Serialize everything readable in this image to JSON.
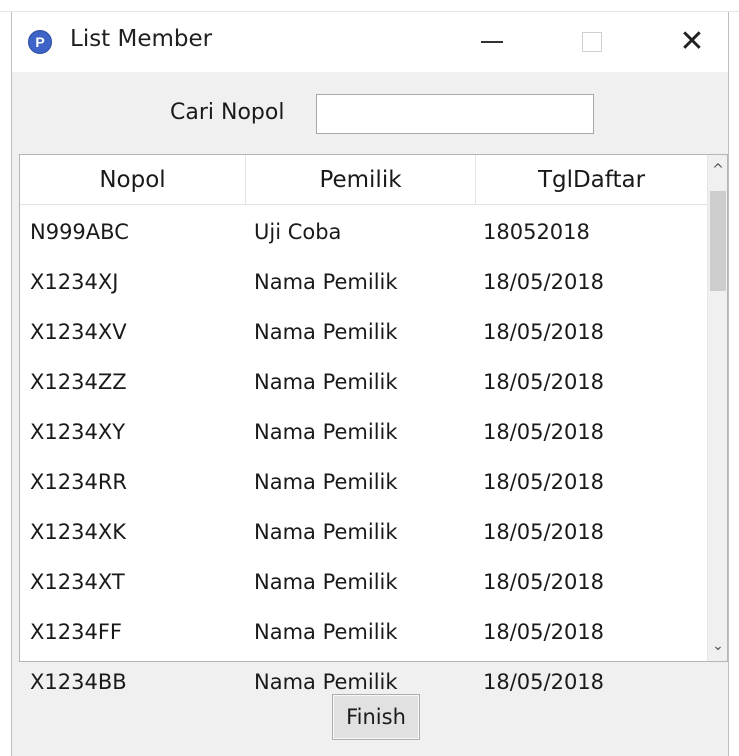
{
  "window": {
    "title": "List Member",
    "icon_letter": "P",
    "close_glyph": "✕"
  },
  "search": {
    "label": "Cari Nopol",
    "value": "",
    "placeholder": ""
  },
  "table": {
    "columns": [
      "Nopol",
      "Pemilik",
      "TglDaftar"
    ],
    "rows": [
      [
        "N999ABC",
        "Uji Coba",
        "18052018"
      ],
      [
        "X1234XJ",
        "Nama Pemilik",
        "18/05/2018"
      ],
      [
        "X1234XV",
        "Nama Pemilik",
        "18/05/2018"
      ],
      [
        "X1234ZZ",
        "Nama Pemilik",
        "18/05/2018"
      ],
      [
        "X1234XY",
        "Nama Pemilik",
        "18/05/2018"
      ],
      [
        "X1234RR",
        "Nama Pemilik",
        "18/05/2018"
      ],
      [
        "X1234XK",
        "Nama Pemilik",
        "18/05/2018"
      ],
      [
        "X1234XT",
        "Nama Pemilik",
        "18/05/2018"
      ],
      [
        "X1234FF",
        "Nama Pemilik",
        "18/05/2018"
      ],
      [
        "X1234BB",
        "Nama Pemilik",
        "18/05/2018"
      ]
    ]
  },
  "scrollbar": {
    "up_glyph": "^",
    "down_glyph": "⌄"
  },
  "footer": {
    "finish_label": "Finish"
  },
  "colors": {
    "window_bg": "#f0f0f0",
    "list_bg": "#ffffff",
    "icon_blue": "#3f64c8"
  }
}
